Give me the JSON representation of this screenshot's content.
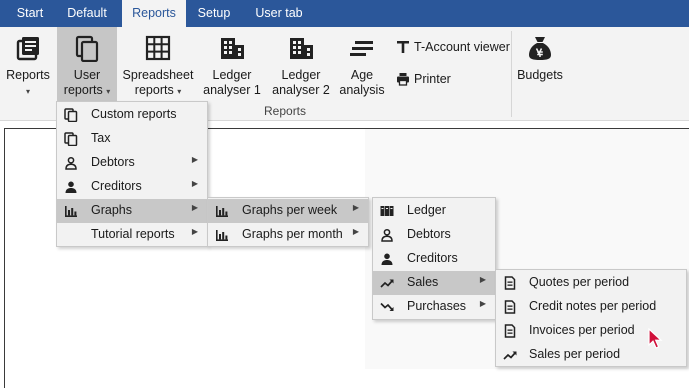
{
  "tabs": [
    {
      "label": "Start",
      "active": false
    },
    {
      "label": "Default",
      "active": false
    },
    {
      "label": "Reports",
      "active": true
    },
    {
      "label": "Setup",
      "active": false
    },
    {
      "label": "User tab",
      "active": false
    }
  ],
  "ribbon": {
    "reports": {
      "line1": "Reports",
      "caret": "▾",
      "icon": "reports-icon"
    },
    "user_reports": {
      "line1": "User",
      "line2": "reports",
      "caret": "▾",
      "icon": "user-reports-icon"
    },
    "spreadsheet": {
      "line1": "Spreadsheet",
      "line2": "reports",
      "caret": "▾",
      "icon": "spreadsheet-icon"
    },
    "ledger1": {
      "line1": "Ledger",
      "line2": "analyser 1",
      "icon": "building-icon"
    },
    "ledger2": {
      "line1": "Ledger",
      "line2": "analyser 2",
      "icon": "building-icon"
    },
    "age": {
      "line1": "Age",
      "line2": "analysis",
      "icon": "age-analysis-icon"
    },
    "taccount": {
      "label": "T-Account viewer",
      "icon": "t-account-icon"
    },
    "printer": {
      "label": "Printer",
      "icon": "printer-icon"
    },
    "budgets": {
      "label": "Budgets",
      "icon": "money-bag-icon"
    },
    "group_label": "Reports"
  },
  "menu_user_reports": [
    {
      "label": "Custom reports",
      "icon": "copy-icon",
      "submenu": false
    },
    {
      "label": "Tax",
      "icon": "copy-icon",
      "submenu": false
    },
    {
      "label": "Debtors",
      "icon": "person-outline-icon",
      "submenu": true
    },
    {
      "label": "Creditors",
      "icon": "person-filled-icon",
      "submenu": true
    },
    {
      "label": "Graphs",
      "icon": "bar-chart-icon",
      "submenu": true,
      "highlighted": true
    },
    {
      "label": "Tutorial reports",
      "icon": "",
      "submenu": true
    }
  ],
  "menu_graphs": [
    {
      "label": "Graphs per week",
      "icon": "bar-chart-icon",
      "submenu": true,
      "highlighted": true
    },
    {
      "label": "Graphs per month",
      "icon": "bar-chart-icon",
      "submenu": true
    }
  ],
  "menu_graphs_per_week": [
    {
      "label": "Ledger",
      "icon": "ledger-icon",
      "submenu": false
    },
    {
      "label": "Debtors",
      "icon": "person-outline-icon",
      "submenu": false
    },
    {
      "label": "Creditors",
      "icon": "person-filled-icon",
      "submenu": false
    },
    {
      "label": "Sales",
      "icon": "trend-up-icon",
      "submenu": true,
      "highlighted": true
    },
    {
      "label": "Purchases",
      "icon": "trend-down-icon",
      "submenu": true
    }
  ],
  "menu_sales": [
    {
      "label": "Quotes per period",
      "icon": "document-icon"
    },
    {
      "label": "Credit notes per period",
      "icon": "document-icon"
    },
    {
      "label": "Invoices per period",
      "icon": "document-icon"
    },
    {
      "label": "Sales per period",
      "icon": "trend-up-icon"
    }
  ],
  "submenu_arrow": "▶",
  "colors": {
    "tabbar": "#2b579a",
    "ribbon": "#f3f3f3",
    "highlight": "#c8c8c8",
    "cursor": "#d0103a"
  }
}
